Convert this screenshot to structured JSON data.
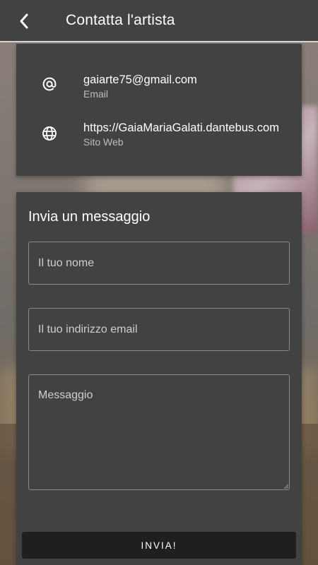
{
  "header": {
    "title": "Contatta l'artista",
    "back_icon": "chevron-left-icon"
  },
  "contacts": [
    {
      "icon": "at-sign-icon",
      "value": "gaiarte75@gmail.com",
      "label": "Email"
    },
    {
      "icon": "globe-icon",
      "value": "https://GaiaMariaGalati.dantebus.com",
      "label": "Sito Web"
    }
  ],
  "form": {
    "heading": "Invia un messaggio",
    "name_placeholder": "Il tuo nome",
    "email_placeholder": "Il tuo indirizzo email",
    "message_placeholder": "Messaggio",
    "submit_label": "INVIA!"
  },
  "colors": {
    "appbar": "#424242",
    "card": "#424242",
    "button": "#1f1f1f",
    "text": "#ffffff",
    "secondary_text": "#bdbdbd"
  }
}
